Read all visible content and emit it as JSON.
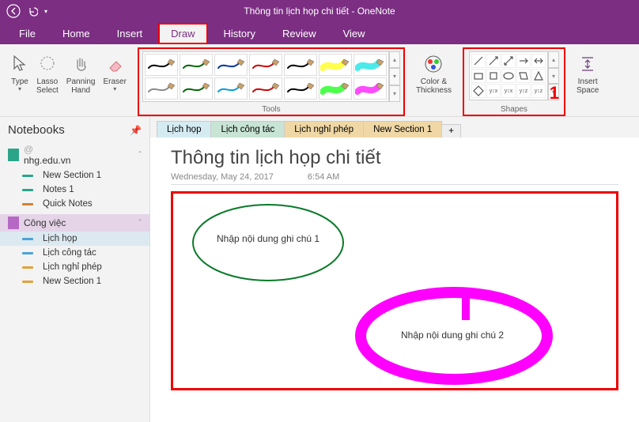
{
  "titlebar": {
    "title": "Thông tin lịch họp chi tiết  -  OneNote"
  },
  "menu": {
    "file": "File",
    "home": "Home",
    "insert": "Insert",
    "draw": "Draw",
    "history": "History",
    "review": "Review",
    "view": "View"
  },
  "ribbon": {
    "type": "Type",
    "lasso": "Lasso\nSelect",
    "panning": "Panning\nHand",
    "eraser": "Eraser",
    "tools_label": "Tools",
    "color": "Color &\nThickness",
    "shapes_label": "Shapes",
    "insert_space": "Insert\nSpace",
    "highlight_number": "1"
  },
  "sidebar": {
    "header": "Notebooks",
    "nb1": {
      "line1": "@",
      "line2": "nhg.edu.vn"
    },
    "nb1_items": [
      "New Section 1",
      "Notes 1",
      "Quick Notes"
    ],
    "nb2": "Công việc",
    "nb2_items": [
      "Lịch họp",
      "Lịch công tác",
      "Lịch nghỉ phép",
      "New Section 1"
    ]
  },
  "tabs": [
    "Lịch họp",
    "Lịch công tác",
    "Lịch nghỉ phép",
    "New Section 1"
  ],
  "tab_add": "+",
  "page": {
    "title": "Thông tin lịch họp chi tiết",
    "date": "Wednesday, May 24, 2017",
    "time": "6:54 AM",
    "note1": "Nhập nội dung ghi chú 1",
    "note2": "Nhập nội dung ghi chú 2"
  },
  "pen_colors_row1": [
    "#000",
    "#006400",
    "#003399",
    "#cc0000",
    "#000",
    "#ffff00",
    "#00e0e0"
  ],
  "pen_colors_row2": [
    "#888",
    "#006400",
    "#0099dd",
    "#cc0000",
    "#000",
    "#00ff00",
    "#ff00ff"
  ],
  "nb1_item_colors": [
    "#2aa58a",
    "#2aa58a",
    "#d08030"
  ],
  "nb2_item_colors": [
    "#4aa3d6",
    "#4aa3d6",
    "#e2a23a",
    "#e2a23a"
  ],
  "tab_colors": [
    "#d4ebf2",
    "#c7e4d4",
    "#f0d8a6",
    "#f0d8a6"
  ]
}
